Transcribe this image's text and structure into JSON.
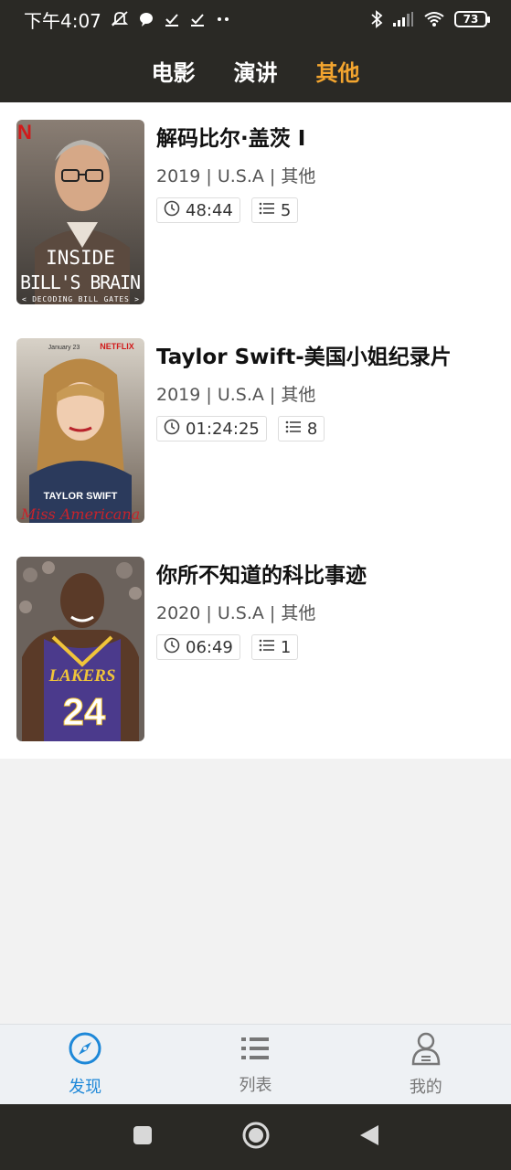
{
  "status_bar": {
    "time": "下午4:07",
    "battery": "73"
  },
  "top_tabs": [
    {
      "label": "电影"
    },
    {
      "label": "演讲"
    },
    {
      "label": "其他",
      "active": true
    }
  ],
  "items": [
    {
      "title": "解码比尔·盖茨 I",
      "meta": "2019 | U.S.A | 其他",
      "duration": "48:44",
      "episodes": "5",
      "poster": {
        "brand": "N",
        "line1": "INSIDE",
        "line2": "BILL'S BRAIN",
        "line3": "< DECODING BILL GATES >"
      }
    },
    {
      "title": "Taylor Swift-美国小姐纪录片",
      "meta": "2019 | U.S.A | 其他",
      "duration": "01:24:25",
      "episodes": "8",
      "poster": {
        "top": "January 23",
        "brand": "NETFLIX",
        "name": "TAYLOR SWIFT",
        "script": "Miss Americana"
      }
    },
    {
      "title": "你所不知道的科比事迹",
      "meta": "2020 | U.S.A | 其他",
      "duration": "06:49",
      "episodes": "1",
      "poster": {
        "jersey_text": "LAKERS",
        "jersey_number": "24"
      }
    }
  ],
  "bottom_nav": [
    {
      "label": "发现",
      "icon": "compass-icon",
      "active": true
    },
    {
      "label": "列表",
      "icon": "list-icon"
    },
    {
      "label": "我的",
      "icon": "user-icon"
    }
  ],
  "colors": {
    "accent": "#f3a52f",
    "nav_active": "#1e88d8",
    "header_bg": "#2a2925"
  }
}
